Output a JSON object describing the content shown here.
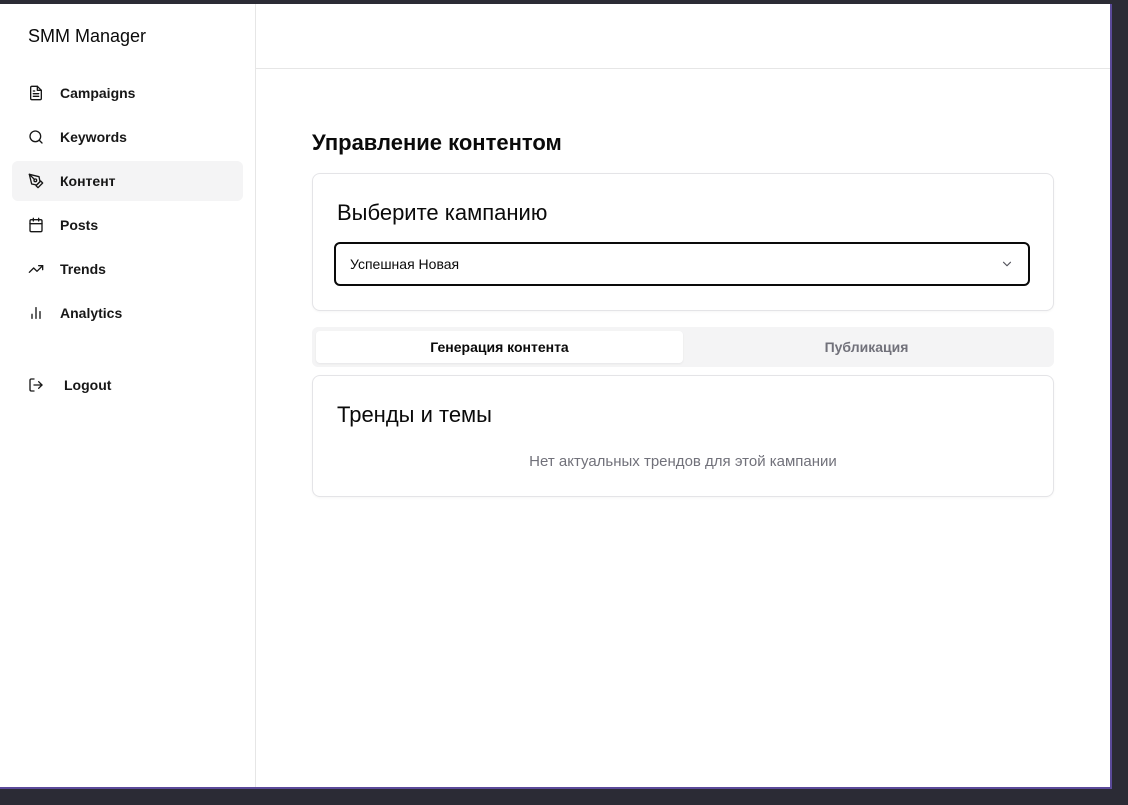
{
  "app": {
    "brand": "SMM Manager"
  },
  "sidebar": {
    "items": [
      {
        "label": "Campaigns",
        "icon": "document-icon",
        "active": false
      },
      {
        "label": "Keywords",
        "icon": "search-icon",
        "active": false
      },
      {
        "label": "Контент",
        "icon": "pen-tool-icon",
        "active": true
      },
      {
        "label": "Posts",
        "icon": "calendar-icon",
        "active": false
      },
      {
        "label": "Trends",
        "icon": "trending-up-icon",
        "active": false
      },
      {
        "label": "Analytics",
        "icon": "bar-chart-icon",
        "active": false
      }
    ],
    "logout_label": "Logout"
  },
  "main": {
    "page_title": "Управление контентом",
    "campaign_card": {
      "title": "Выберите кампанию",
      "selected_value": "Успешная Новая"
    },
    "tabs": [
      {
        "label": "Генерация контента",
        "active": true
      },
      {
        "label": "Публикация",
        "active": false
      }
    ],
    "trends_card": {
      "title": "Тренды и темы",
      "empty_text": "Нет актуальных трендов для этой кампании"
    }
  },
  "colors": {
    "accent_border": "#0a0a0a",
    "active_nav_bg": "#f4f4f5",
    "muted_text": "#71717a",
    "window_frame": "#5b4a9a"
  }
}
